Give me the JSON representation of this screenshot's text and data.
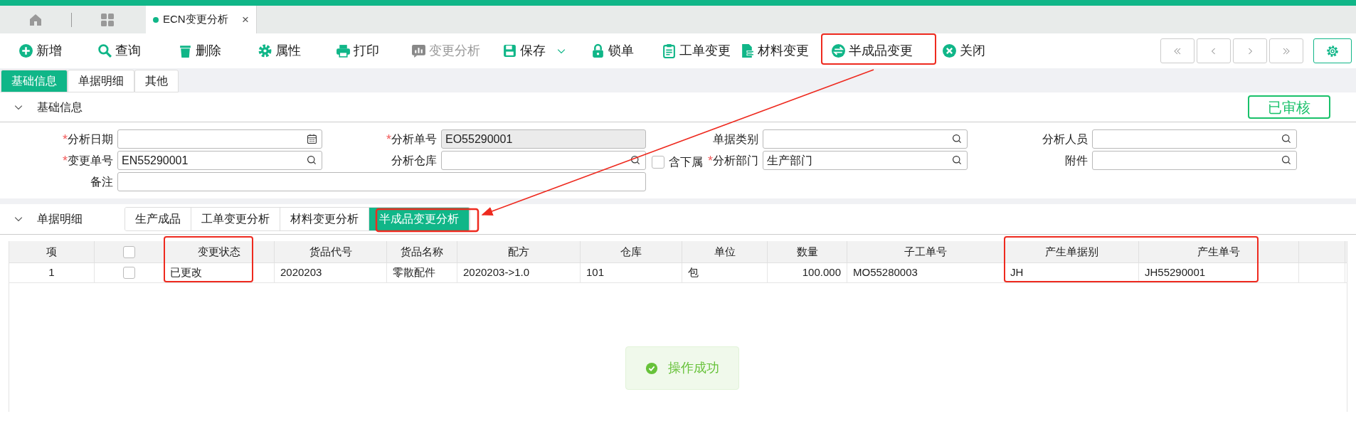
{
  "app_tabs": [
    {
      "label": "ECN变更分析",
      "selected": true,
      "close": "×"
    }
  ],
  "toolbar": [
    {
      "label": "新增",
      "disabled": false
    },
    {
      "label": "查询",
      "disabled": false
    },
    {
      "label": "删除",
      "disabled": false
    },
    {
      "label": "属性",
      "disabled": false
    },
    {
      "label": "打印",
      "disabled": false
    },
    {
      "label": "变更分析",
      "disabled": true
    },
    {
      "label": "保存",
      "disabled": false,
      "dropdown": true
    },
    {
      "label": "锁单",
      "disabled": false
    },
    {
      "label": "工单变更",
      "disabled": false
    },
    {
      "label": "材料变更",
      "disabled": false
    },
    {
      "label": "半成品变更",
      "disabled": false
    },
    {
      "label": "关闭",
      "disabled": false
    }
  ],
  "page_tabs": [
    {
      "label": "基础信息",
      "selected": true
    },
    {
      "label": "单据明细",
      "selected": false
    },
    {
      "label": "其他",
      "selected": false
    }
  ],
  "basic_section": {
    "title": "基础信息",
    "status": "已审核",
    "expanded": true
  },
  "form_fields": [
    {
      "label": "分析日期",
      "required_mark": "*",
      "kind": "date"
    },
    {
      "label": "分析单号",
      "required_mark": "*",
      "kind": "readonly",
      "value": "EO55290001"
    },
    {
      "label": "单据类别",
      "kind": "lookup"
    },
    {
      "label": "分析人员",
      "kind": "lookup"
    },
    {
      "label": "变更单号",
      "required_mark": "*",
      "kind": "lookup",
      "value": "EN55290001"
    },
    {
      "label": "分析仓库",
      "kind": "lookup",
      "checkbox": {
        "label": "含下属",
        "checked": false
      }
    },
    {
      "label": "分析部门",
      "required_mark": "*",
      "kind": "lookup",
      "value": "生产部门"
    },
    {
      "label": "附件",
      "kind": "lookup"
    },
    {
      "label": "备注",
      "kind": "wide"
    }
  ],
  "detail_section": {
    "title": "单据明细",
    "expanded": true
  },
  "detail_tabs": [
    {
      "label": "生产成品",
      "selected": false
    },
    {
      "label": "工单变更分析",
      "selected": false
    },
    {
      "label": "材料变更分析",
      "selected": false
    },
    {
      "label": "半成品变更分析",
      "selected": true
    }
  ],
  "table": {
    "columns": [
      "项",
      "",
      "变更状态",
      "货品代号",
      "货品名称",
      "配方",
      "仓库",
      "单位",
      "数量",
      "子工单号",
      "产生单据别",
      "产生单号",
      ""
    ],
    "header_checked": false,
    "rows": [
      {
        "checked": false,
        "cells": [
          "1",
          "",
          "已更改",
          "2020203",
          "零散配件",
          "2020203->1.0",
          "101",
          "包",
          "100.000",
          "MO55280003",
          "JH",
          "JH55290001",
          ""
        ]
      }
    ]
  },
  "toast": {
    "message": "操作成功"
  }
}
